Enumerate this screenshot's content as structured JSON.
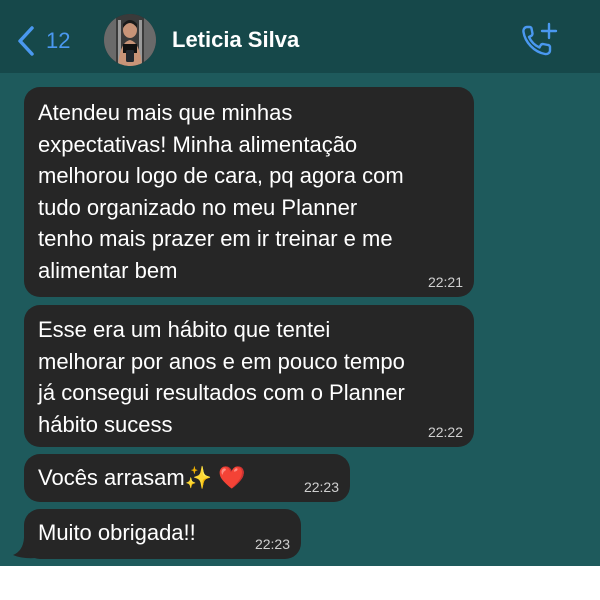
{
  "header": {
    "back_count": "12",
    "contact_name": "Leticia Silva"
  },
  "messages": [
    {
      "text": "Atendeu mais que minhas\nexpectativas! Minha alimentação\nmelhorou logo de cara, pq agora com\ntudo organizado no meu Planner\ntenho mais prazer em ir treinar e me\nalimentar bem",
      "time": "22:21"
    },
    {
      "text": "Esse era um hábito que tentei\nmelhorar por anos e em pouco tempo\njá consegui resultados com o Planner\nhábito sucess",
      "time": "22:22"
    },
    {
      "text": "Vocês arrasam✨ ❤️",
      "time": "22:23"
    },
    {
      "text": "Muito obrigada!!",
      "time": "22:23"
    }
  ],
  "colors": {
    "background": "#1e5a5c",
    "header": "#16484a",
    "bubble": "#262626",
    "accent": "#4a98f0"
  },
  "icons": [
    "back-chevron-icon",
    "add-call-icon"
  ]
}
